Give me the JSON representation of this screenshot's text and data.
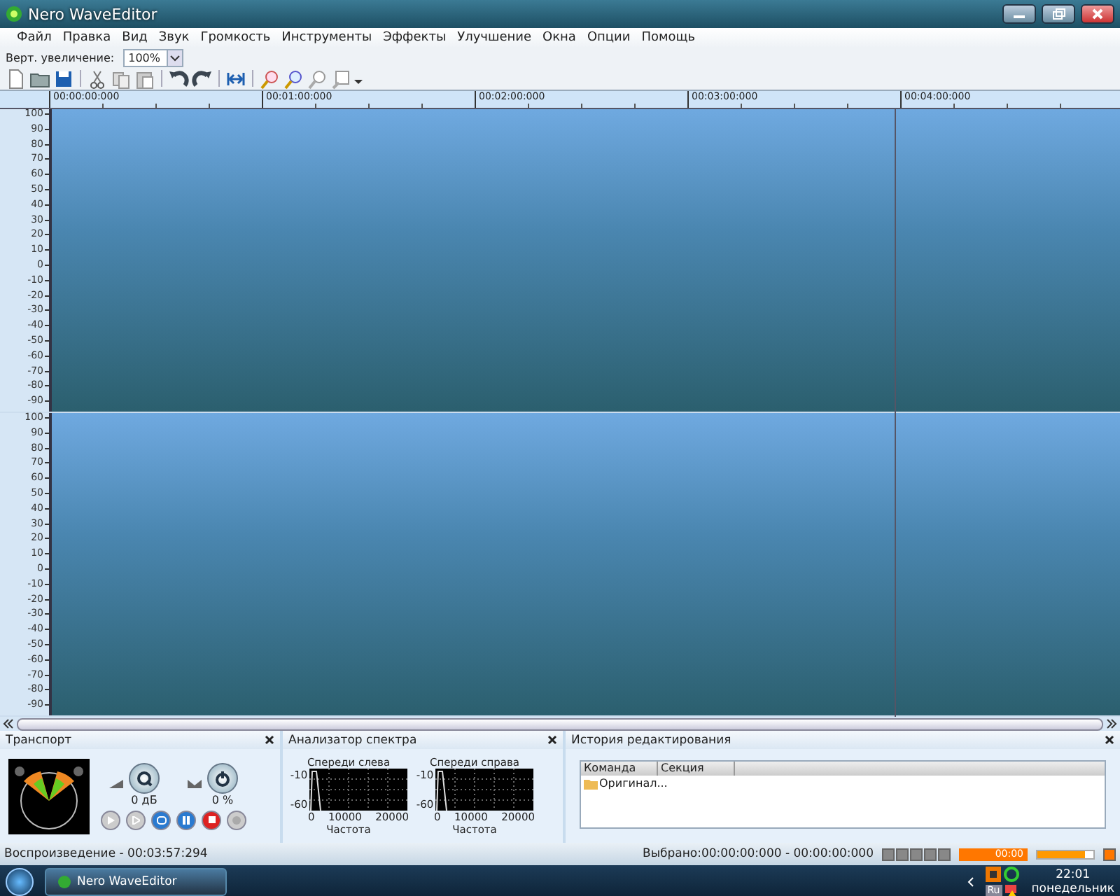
{
  "window": {
    "title": "Nero WaveEditor"
  },
  "menu": [
    {
      "label": "Файл"
    },
    {
      "label": "Правка"
    },
    {
      "label": "Вид"
    },
    {
      "label": "Звук"
    },
    {
      "label": "Громкость"
    },
    {
      "label": "Инструменты"
    },
    {
      "label": "Эффекты"
    },
    {
      "label": "Улучшение"
    },
    {
      "label": "Окна"
    },
    {
      "label": "Опции"
    },
    {
      "label": "Помощь"
    }
  ],
  "zoom_bar": {
    "label": "Верт. увеличение:",
    "value": "100%"
  },
  "ruler": {
    "ticks": [
      "00:00:00:000",
      "00:01:00:000",
      "00:02:00:000",
      "00:03:00:000",
      "00:04:00:000"
    ]
  },
  "channels": [
    {
      "axis_labels": [
        "100",
        "90",
        "80",
        "70",
        "60",
        "50",
        "40",
        "30",
        "20",
        "10",
        "0",
        "-10",
        "-20",
        "-30",
        "-40",
        "-50",
        "-60",
        "-70",
        "-80",
        "-90"
      ]
    },
    {
      "axis_labels": [
        "100",
        "90",
        "80",
        "70",
        "60",
        "50",
        "40",
        "30",
        "20",
        "10",
        "0",
        "-10",
        "-20",
        "-30",
        "-40",
        "-50",
        "-60",
        "-70",
        "-80",
        "-90"
      ]
    }
  ],
  "transport": {
    "title": "Транспорт",
    "volume_reading": "0 дБ",
    "balance_reading": "0 %"
  },
  "spectrum": {
    "title": "Анализатор спектра",
    "plots": [
      {
        "title": "Спереди слева",
        "y_labels": [
          "-10",
          "-60"
        ],
        "x_labels": [
          "0",
          "10000",
          "20000"
        ],
        "xlabel": "Частота"
      },
      {
        "title": "Спереди справа",
        "y_labels": [
          "-10",
          "-60"
        ],
        "x_labels": [
          "0",
          "10000",
          "20000"
        ],
        "xlabel": "Частота"
      }
    ]
  },
  "history": {
    "title": "История редактирования",
    "columns": [
      "Команда",
      "Секция"
    ],
    "rows": [
      {
        "command": "Оригинал..."
      }
    ]
  },
  "status_bar": {
    "left": "Воспроизведение - 00:03:57:294",
    "right": "Выбрано:00:00:00:000 - 00:00:00:000",
    "player_time": "00:00",
    "volume": {
      "level": 0.85
    }
  },
  "taskbar": {
    "task": "Nero WaveEditor",
    "language": "Ru",
    "time": "22:01",
    "day": "понедельник"
  }
}
